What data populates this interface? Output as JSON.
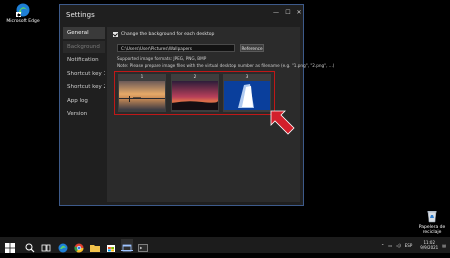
{
  "desktop": {
    "edge_label": "Microsoft Edge",
    "recycle_label": "Papelera de reciclaje"
  },
  "window": {
    "title": "Settings",
    "controls": {
      "minimize": "—",
      "maximize": "☐",
      "close": "✕"
    }
  },
  "sidebar": {
    "items": [
      {
        "label": "General",
        "state": "active"
      },
      {
        "label": "Background",
        "state": "selected"
      },
      {
        "label": "Notification",
        "state": "normal"
      },
      {
        "label": "Shortcut key 1",
        "state": "normal"
      },
      {
        "label": "Shortcut key 2",
        "state": "normal"
      },
      {
        "label": "App log",
        "state": "normal"
      },
      {
        "label": "Version",
        "state": "normal"
      }
    ]
  },
  "background": {
    "checkbox_label": "Change the background for each desktop",
    "checkbox_checked": true,
    "path_value": "C:\\Users\\User\\Pictures\\Wallpapers",
    "reference_button": "Reference",
    "formats_note": "Supported image formats: JPEG, PNG, BMP",
    "prepare_note": "Note: Please prepare image files with the virtual desktop number as filename (e.g. \"1.png\", \"2.png\", ...)",
    "thumbnails": [
      {
        "number": "1"
      },
      {
        "number": "2"
      },
      {
        "number": "3"
      }
    ]
  },
  "taskbar": {
    "language": "ESP",
    "time": "11:02",
    "date": "9/9/2021"
  }
}
